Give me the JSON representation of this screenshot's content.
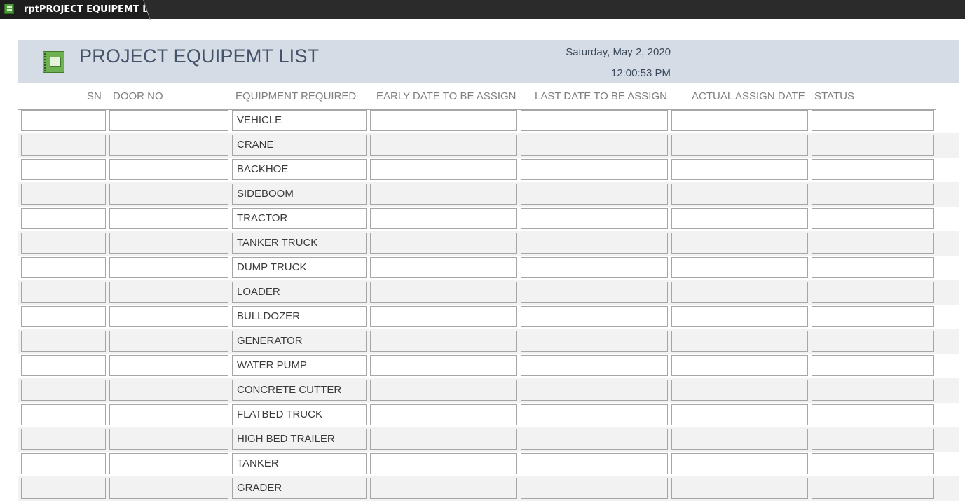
{
  "tab": {
    "label": "rptPROJECT EQUIPEMT LIST",
    "icon": "report-icon"
  },
  "header": {
    "title": "PROJECT EQUIPEMT LIST",
    "date": "Saturday, May 2, 2020",
    "time": "12:00:53 PM"
  },
  "columns": {
    "sn": "SN",
    "door_no": "DOOR NO",
    "equipment": "EQUIPMENT REQUIRED",
    "early_date": "EARLY DATE TO BE ASSIGN",
    "last_date": "LAST DATE TO BE ASSIGN",
    "actual_date": "ACTUAL ASSIGN DATE",
    "status": "STATUS"
  },
  "rows": [
    {
      "sn": "",
      "door_no": "",
      "equipment": "VEHICLE",
      "early_date": "",
      "last_date": "",
      "actual_date": "",
      "status": ""
    },
    {
      "sn": "",
      "door_no": "",
      "equipment": "CRANE",
      "early_date": "",
      "last_date": "",
      "actual_date": "",
      "status": ""
    },
    {
      "sn": "",
      "door_no": "",
      "equipment": "BACKHOE",
      "early_date": "",
      "last_date": "",
      "actual_date": "",
      "status": ""
    },
    {
      "sn": "",
      "door_no": "",
      "equipment": "SIDEBOOM",
      "early_date": "",
      "last_date": "",
      "actual_date": "",
      "status": ""
    },
    {
      "sn": "",
      "door_no": "",
      "equipment": "TRACTOR",
      "early_date": "",
      "last_date": "",
      "actual_date": "",
      "status": ""
    },
    {
      "sn": "",
      "door_no": "",
      "equipment": "TANKER TRUCK",
      "early_date": "",
      "last_date": "",
      "actual_date": "",
      "status": ""
    },
    {
      "sn": "",
      "door_no": "",
      "equipment": "DUMP TRUCK",
      "early_date": "",
      "last_date": "",
      "actual_date": "",
      "status": ""
    },
    {
      "sn": "",
      "door_no": "",
      "equipment": "LOADER",
      "early_date": "",
      "last_date": "",
      "actual_date": "",
      "status": ""
    },
    {
      "sn": "",
      "door_no": "",
      "equipment": "BULLDOZER",
      "early_date": "",
      "last_date": "",
      "actual_date": "",
      "status": ""
    },
    {
      "sn": "",
      "door_no": "",
      "equipment": "GENERATOR",
      "early_date": "",
      "last_date": "",
      "actual_date": "",
      "status": ""
    },
    {
      "sn": "",
      "door_no": "",
      "equipment": "WATER PUMP",
      "early_date": "",
      "last_date": "",
      "actual_date": "",
      "status": ""
    },
    {
      "sn": "",
      "door_no": "",
      "equipment": "CONCRETE CUTTER",
      "early_date": "",
      "last_date": "",
      "actual_date": "",
      "status": ""
    },
    {
      "sn": "",
      "door_no": "",
      "equipment": "FLATBED TRUCK",
      "early_date": "",
      "last_date": "",
      "actual_date": "",
      "status": ""
    },
    {
      "sn": "",
      "door_no": "",
      "equipment": "HIGH BED TRAILER",
      "early_date": "",
      "last_date": "",
      "actual_date": "",
      "status": ""
    },
    {
      "sn": "",
      "door_no": "",
      "equipment": "TANKER",
      "early_date": "",
      "last_date": "",
      "actual_date": "",
      "status": ""
    },
    {
      "sn": "",
      "door_no": "",
      "equipment": "GRADER",
      "early_date": "",
      "last_date": "",
      "actual_date": "",
      "status": ""
    }
  ],
  "colors": {
    "header_band": "#d6dce5",
    "title_text": "#44546a",
    "alt_row": "#f2f2f2",
    "tab_bar": "#2b2b2b"
  }
}
